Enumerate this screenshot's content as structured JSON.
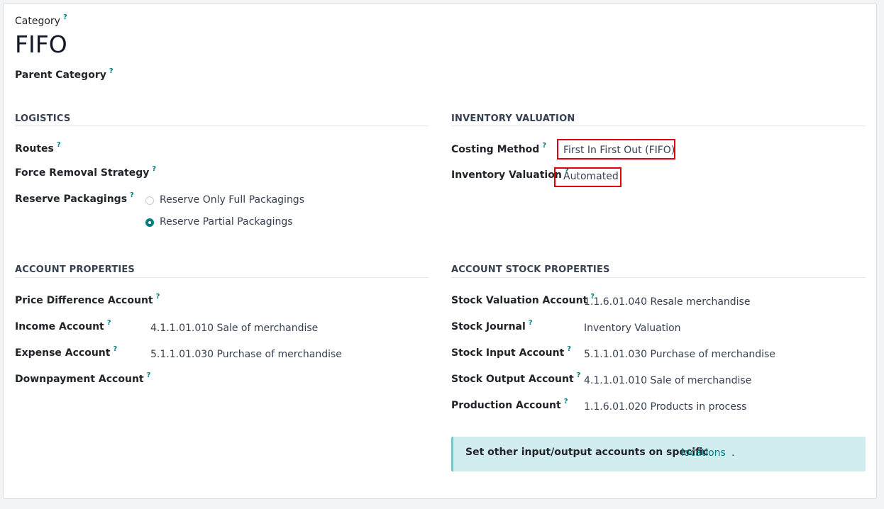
{
  "header": {
    "category_label": "Category",
    "title": "FIFO",
    "parent_category_label": "Parent Category",
    "help_mark": "?"
  },
  "logistics": {
    "title": "LOGISTICS",
    "routes_label": "Routes",
    "force_removal_label": "Force Removal Strategy",
    "reserve_packagings_label": "Reserve Packagings",
    "options": [
      {
        "label": "Reserve Only Full Packagings",
        "selected": false
      },
      {
        "label": "Reserve Partial Packagings",
        "selected": true
      }
    ]
  },
  "inventory_valuation": {
    "title": "INVENTORY VALUATION",
    "costing_method_label": "Costing Method",
    "costing_method_value": "First In First Out (FIFO)",
    "valuation_label": "Inventory Valuation",
    "valuation_value": "Automated"
  },
  "account_properties": {
    "title": "ACCOUNT PROPERTIES",
    "price_diff_label": "Price Difference Account",
    "income_label": "Income Account",
    "income_value": "4.1.1.01.010 Sale of merchandise",
    "expense_label": "Expense Account",
    "expense_value": "5.1.1.01.030 Purchase of merchandise",
    "downpayment_label": "Downpayment Account"
  },
  "account_stock_properties": {
    "title": "ACCOUNT STOCK PROPERTIES",
    "stock_valuation_label": "Stock Valuation Account",
    "stock_valuation_value": "1.1.6.01.040 Resale merchandise",
    "stock_journal_label": "Stock Journal",
    "stock_journal_value": "Inventory Valuation",
    "stock_input_label": "Stock Input Account",
    "stock_input_value": "5.1.1.01.030 Purchase of merchandise",
    "stock_output_label": "Stock Output Account",
    "stock_output_value": "4.1.1.01.010 Sale of merchandise",
    "production_label": "Production Account",
    "production_value": "1.1.6.01.020 Products in process"
  },
  "info_banner": {
    "text": "Set other input/output accounts on specific",
    "link": "locations",
    "suffix": "."
  },
  "colors": {
    "accent": "#017e84",
    "highlight": "#e0000d",
    "banner_bg": "#d2edf0"
  }
}
